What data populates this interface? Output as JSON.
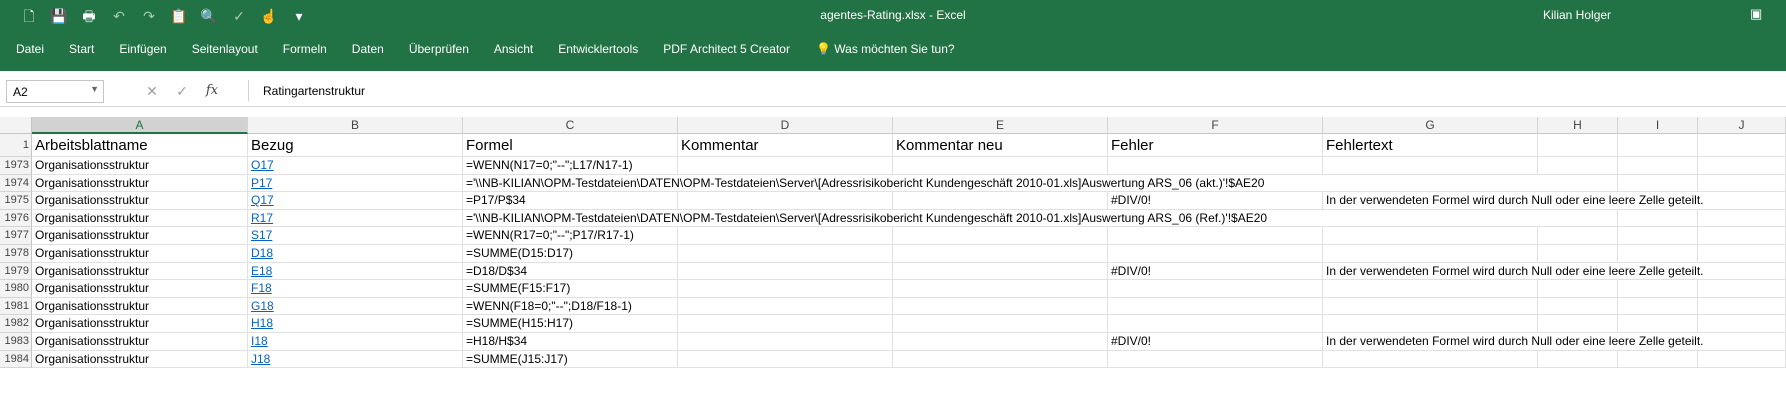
{
  "window": {
    "title": "agentes-Rating.xlsx  -  Excel",
    "user": "Kilian Holger"
  },
  "quick_access": [
    "new-file-icon",
    "save-icon",
    "print-icon",
    "undo-icon",
    "redo-icon",
    "paste-icon",
    "print-preview-icon",
    "spelling-icon",
    "touch-mode-icon",
    "customize-icon"
  ],
  "ribbon": {
    "tabs": [
      "Datei",
      "Start",
      "Einfügen",
      "Seitenlayout",
      "Formeln",
      "Daten",
      "Überprüfen",
      "Ansicht",
      "Entwicklertools",
      "PDF Architect 5 Creator"
    ],
    "tell_me": "Was möchten Sie tun?"
  },
  "formula_bar": {
    "name_box": "A2",
    "formula": "Ratingartenstruktur"
  },
  "columns": [
    "A",
    "B",
    "C",
    "D",
    "E",
    "F",
    "G",
    "H",
    "I",
    "J"
  ],
  "header_row": {
    "row": "1",
    "cells": [
      "Arbeitsblattname",
      "Bezug",
      "Formel",
      "Kommentar",
      "Kommentar neu",
      "Fehler",
      "Fehlertext"
    ]
  },
  "rows": [
    {
      "row": "1973",
      "a": "Organisationsstruktur",
      "b": "O17",
      "c": "=WENN(N17=0;\"--\";L17/N17-1)",
      "f": "",
      "g": ""
    },
    {
      "row": "1974",
      "a": "Organisationsstruktur",
      "b": "P17",
      "c": "='\\\\NB-KILIAN\\OPM-Testdateien\\DATEN\\OPM-Testdateien\\Server\\[Adressrisikobericht Kundengeschäft 2010-01.xls]Auswertung ARS_06 (akt.)'!$AE20",
      "f": "",
      "g": ""
    },
    {
      "row": "1975",
      "a": "Organisationsstruktur",
      "b": "Q17",
      "c": "=P17/P$34",
      "f": "#DIV/0!",
      "g": "In der verwendeten Formel wird durch Null oder eine leere Zelle geteilt."
    },
    {
      "row": "1976",
      "a": "Organisationsstruktur",
      "b": "R17",
      "c": "='\\\\NB-KILIAN\\OPM-Testdateien\\DATEN\\OPM-Testdateien\\Server\\[Adressrisikobericht Kundengeschäft 2010-01.xls]Auswertung ARS_06 (Ref.)'!$AE20",
      "f": "",
      "g": ""
    },
    {
      "row": "1977",
      "a": "Organisationsstruktur",
      "b": "S17",
      "c": "=WENN(R17=0;\"--\";P17/R17-1)",
      "f": "",
      "g": ""
    },
    {
      "row": "1978",
      "a": "Organisationsstruktur",
      "b": "D18",
      "c": "=SUMME(D15:D17)",
      "f": "",
      "g": ""
    },
    {
      "row": "1979",
      "a": "Organisationsstruktur",
      "b": "E18",
      "c": "=D18/D$34",
      "f": "#DIV/0!",
      "g": "In der verwendeten Formel wird durch Null oder eine leere Zelle geteilt."
    },
    {
      "row": "1980",
      "a": "Organisationsstruktur",
      "b": "F18",
      "c": "=SUMME(F15:F17)",
      "f": "",
      "g": ""
    },
    {
      "row": "1981",
      "a": "Organisationsstruktur",
      "b": "G18",
      "c": "=WENN(F18=0;\"--\";D18/F18-1)",
      "f": "",
      "g": ""
    },
    {
      "row": "1982",
      "a": "Organisationsstruktur",
      "b": "H18",
      "c": "=SUMME(H15:H17)",
      "f": "",
      "g": ""
    },
    {
      "row": "1983",
      "a": "Organisationsstruktur",
      "b": "I18",
      "c": "=H18/H$34",
      "f": "#DIV/0!",
      "g": "In der verwendeten Formel wird durch Null oder eine leere Zelle geteilt."
    },
    {
      "row": "1984",
      "a": "Organisationsstruktur",
      "b": "J18",
      "c": "=SUMME(J15:J17)",
      "f": "",
      "g": ""
    }
  ],
  "colors": {
    "excel_green": "#217346",
    "link": "#0563c1"
  }
}
